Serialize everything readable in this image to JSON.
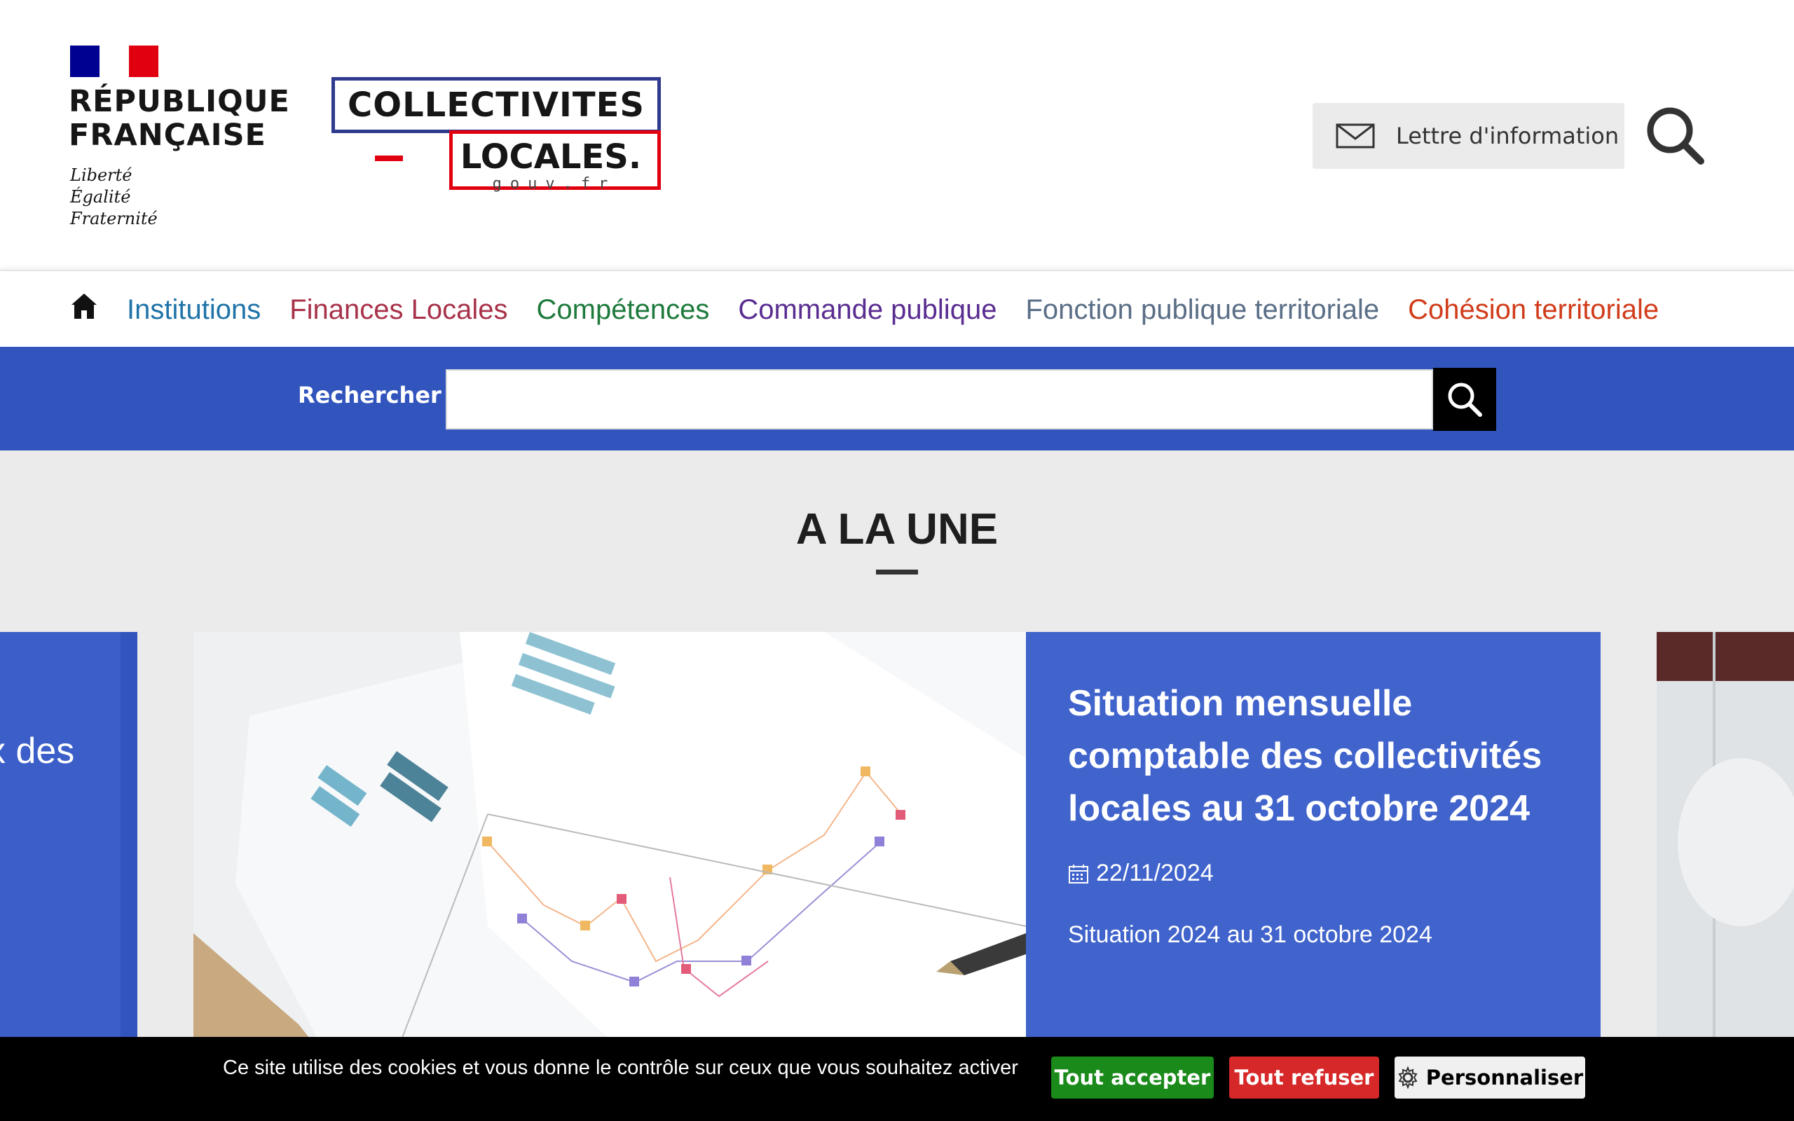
{
  "header": {
    "rf_name": "RÉPUBLIQUE\nFRANÇAISE",
    "rf_motto": "Liberté\nÉgalité\nFraternité",
    "site_logo_top": "COLLECTIVITES",
    "site_logo_bottom": "LOCALES.",
    "site_logo_domain": "gouv.fr",
    "newsletter_label": "Lettre d'information"
  },
  "nav": {
    "items": [
      {
        "label": "Institutions",
        "color": "#1f73a8"
      },
      {
        "label": "Finances Locales",
        "color": "#a8324a"
      },
      {
        "label": "Compétences",
        "color": "#1e7a3c"
      },
      {
        "label": "Commande publique",
        "color": "#5a2d91"
      },
      {
        "label": "Fonction publique territoriale",
        "color": "#5a6e86"
      },
      {
        "label": "Cohésion territoriale",
        "color": "#d13c1a"
      }
    ]
  },
  "search": {
    "label": "Rechercher",
    "value": ""
  },
  "une": {
    "title": "A LA UNE",
    "left_card_text": "x des",
    "main_card": {
      "title": "Situation mensuelle comptable des collectivités locales au 31 octobre 2024",
      "date": "22/11/2024",
      "description": "Situation 2024 au 31 octobre 2024"
    }
  },
  "cookie": {
    "message": "Ce site utilise des cookies et vous donne le contrôle sur ceux que vous souhaitez activer",
    "accept": "Tout accepter",
    "refuse": "Tout refuser",
    "customize": "Personnaliser"
  },
  "colors": {
    "band_blue": "#3155bd",
    "card_blue": "#4063cc",
    "accept_green": "#1a8a1a",
    "refuse_red": "#d62828"
  }
}
